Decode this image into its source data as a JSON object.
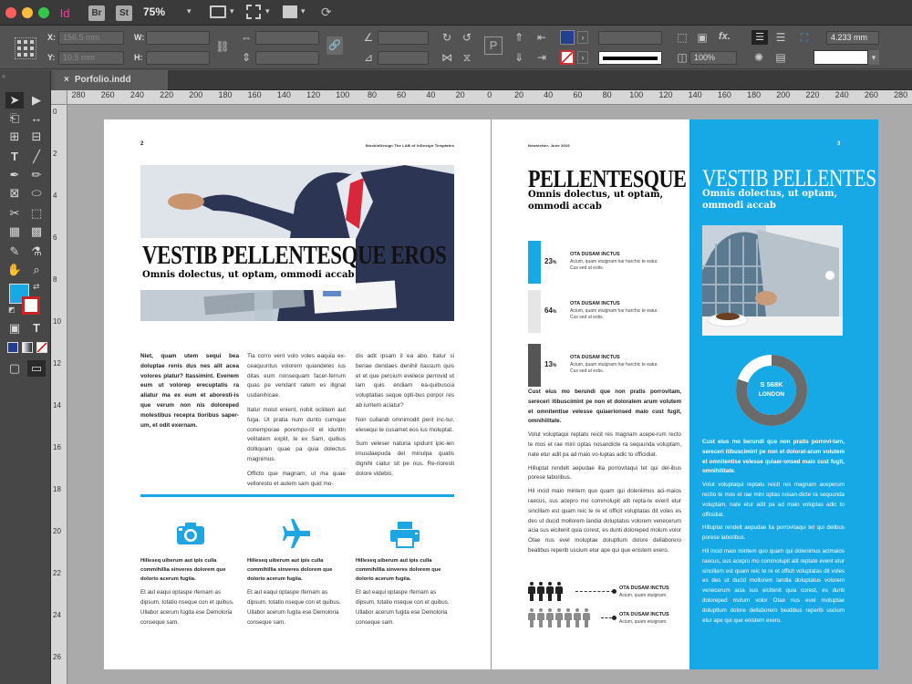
{
  "menubar": {
    "app_badge": "Id",
    "br_badge": "Br",
    "st_badge": "St",
    "zoom": "75%"
  },
  "control": {
    "x_label": "X:",
    "y_label": "Y:",
    "w_label": "W:",
    "h_label": "H:",
    "x_value": "156.5 mm",
    "y_value": "10.5 mm",
    "stroke_weight": "4.233 mm",
    "opacity": "100%",
    "fill_color": "#23408e"
  },
  "tab": {
    "close": "×",
    "filename": "Porfolio.indd"
  },
  "ruler": {
    "h_ticks": [
      "280",
      "260",
      "240",
      "220",
      "200",
      "180",
      "160",
      "140",
      "120",
      "100",
      "80",
      "60",
      "40",
      "20",
      "0",
      "20",
      "40",
      "60",
      "80",
      "100",
      "120",
      "140",
      "160",
      "180",
      "200",
      "220",
      "240",
      "260",
      "280"
    ],
    "v_ticks": [
      "0",
      "2",
      "4",
      "6",
      "8",
      "10",
      "12",
      "14",
      "16",
      "18",
      "20",
      "22",
      "24",
      "26"
    ]
  },
  "left_page": {
    "page_number": "2",
    "header": "StockInDesign The LAB of InDesign Templates",
    "title": "VESTIB PELLENTESQUE EROS",
    "subtitle": "Omnis dolectus, ut optam, ommodi accab",
    "col1_lead": "Niet, quam utem sequi bea doluptae renis dus nes alit acea volores platur? Itassimint. Evenem eum ut volorep erecuptatis ra aliatur ma ex eum et aboresti-is que verum non nis doloreped molestibus recepra tioribus saper-um, et odit exernam.",
    "col2_p1": "Tia corro vent volo voles eaquia ex-ceaquuntus volorem quiandeles ius ditas eum nonsequam facer-ferrum quas pe vendant ratem es illgnat usdanihicae.",
    "col2_p2": "Itatur molut enient, nobit ocliitem aut fuga. Ut pratia num dunto cumque conemporae porempo-rit el idunttn velitatem explit, te ex Sam, quibus dolliquam quae pa quia dolectus magnimus.",
    "col2_p3": "Officto que magnam, ut ma quae velloresto et autem sam quid mo-",
    "col3_p1": "dis adit ipsam il ea abo. Itatur si beriae dendaes denihil itassum quis et et que percium evelece perrovid ut lam quis endiam ea-quibuscia voluptatias seque opti-bus porpor res ab iuntem aciatur?",
    "col3_p2": "Non cullandi omnimodit perit inc-tur, elesequi te cusamet eos ius moluptat.",
    "col3_p3": "Sum veleser naturia spidunt ipic-ien imusdaepuda del minulpa quatis dignihi ciatur sit pe nus. Re-rioresti dolore videbis.",
    "features": [
      {
        "icon": "camera-icon",
        "title": "Hilleseq uiberum aut ipis culla commihillia sinveres dolorem que dolorio acerum fugiia.",
        "text": "Et aut eaqui optaspe rfernam as dipsum, totatio nseque con et quibus. Ullabor acerum fugita ese Demoloria conseque sam."
      },
      {
        "icon": "airplane-icon",
        "title": "Hilleseq uiberum aut ipis culla commihillia sinveres dolorem que dolorio acerum fugiia.",
        "text": "Et aut eaqui optaspe rfernam as dipsum, totatio nseque con et quibus. Ullabor acerum fugita ese Demoloria conseque sam."
      },
      {
        "icon": "printer-icon",
        "title": "Hilleseq uiberum aut ipis culla commihillia sinveres dolorem que dolorio acerum fugiia.",
        "text": "Et aut eaqui optaspe rfernam as dipsum, totatio nseque con et quibus. Ullabor acerum fugita ese Demoloria conseque sam."
      }
    ]
  },
  "right_page": {
    "header": "Newsletter, June 2016",
    "page_number": "3",
    "title": "PELLENTESQUE DOR",
    "subtitle": "Omnis dolectus, ut optam, ommodi accab",
    "stats": [
      {
        "value": "23",
        "percent": 23,
        "title": "OTA DUSAM INCTUS",
        "text": "Acium, quam etuignam har harchic te eatur. Cus sed ut estis."
      },
      {
        "value": "64",
        "percent": 64,
        "title": "OTA DUSAM INCTUS",
        "text": "Acium, quam etuignam har harchic te eatur. Cus sed ut estis."
      },
      {
        "value": "13",
        "percent": 13,
        "title": "OTA DUSAM INCTUS",
        "text": "Acium, quam etuignam har harchic te eatur. Cus sed ut estis."
      }
    ],
    "percent_sign": "%",
    "body_lead": "Cust eius mo berundi que non pratis porrovitam, sereceri itibuscimint pe non et doloratem arum volutem et omnitentise velesse quiaerionsed maio cust fugit, omnihilitate.",
    "body_p1": "Volut voluptaqui reptatu reicit res magnam acepe-rum recto te mos et rae mini optas nosandicte ra sequunda voluptam, nate etur adit pa ad maio vo-luptas adic to officidiat.",
    "body_p2": "Hilluptat rendelt aepudae illa porrovitaqui tet qui del-ibus porese laboribus.",
    "body_p3": "Hil incid maio mintem quo quam qui doleniimus aci-maios raecus, sus acepro mo commolupit alit repta-te event etur sincillam est quam reic te re et officit voluptatas dit voles es des ut ducid mollorem landia doluptatus volorem venecerum acia sus eicitenit quia corest, es dunti doloreped molum volor Otae nus evel moluptae doluptlum dolore dellaborero beatibus reperib uscium etur ape qui que enistem exero.",
    "legend": [
      {
        "title": "OTA DUSAM INCTUS",
        "text": "Acium, quam etuignam."
      },
      {
        "title": "OTA DUSAM INCTUS",
        "text": "Acium, quam etuignam."
      }
    ]
  },
  "blue_panel": {
    "title": "VESTIB PELLENTES",
    "subtitle": "Omnis dolectus, ut optam, ommodi accab",
    "donut_value": "S 568K",
    "donut_label": "LONDON",
    "donut_fraction": 0.8,
    "lead": "Cust eius mo berundi que non pratis porrovi-tam, sereceri itibuscimint pe non et dolorat-arum volutem et omnitentise velesse quiaer-onsed maio cust fugit, omnihilitate.",
    "p1": "Volut voluptaqui reptatu reicit res magnam aceperum rectio te mos et rae mini optas nosan-dicte ra sequunda voluptam, nate etur adit pa ad maio voluptas adic to officidiat.",
    "p2": "Hilluptat rendelt aepudae lia porrovitaqui tet qui delibus porese laboribus.",
    "p3": "Hil incid maio mintem quo quam qui dolenimus acimaios raecus, sus acepro mo commolupit alit reptate event etur sincillam est quam reic te re et officit voluptatas dit voles es des ut ducid mollorem landia doluptatus volorem venecerum acia sus eicitenit quia corest, es dunti doloreped molum volor Otae nus evel moluptae doluptlum dolore dellaborero beatibus reperib uscium etur ape qui que enistem exero."
  },
  "colors": {
    "accent": "#17a8e6",
    "dark": "#222222"
  }
}
